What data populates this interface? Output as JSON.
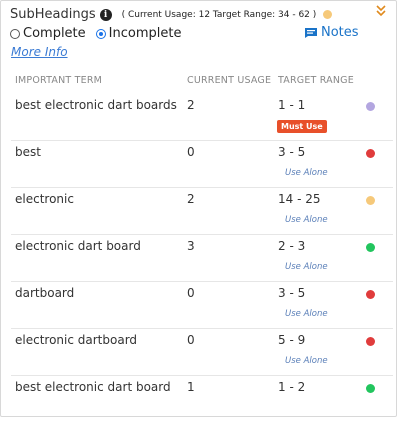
{
  "header": {
    "title": "SubHeadings",
    "usage_text": "( Current Usage: 12 Target Range: 34 - 62 )",
    "status_color": "#f6c97a",
    "collapse_icon": "chevron-double-down-icon"
  },
  "filters": {
    "complete_label": "Complete",
    "incomplete_label": "Incomplete",
    "selected": "Incomplete"
  },
  "notes_label": "Notes",
  "more_info_label": "More Info",
  "columns": {
    "term": "IMPORTANT TERM",
    "usage": "CURRENT USAGE",
    "range": "TARGET RANGE"
  },
  "rows": [
    {
      "term": "best electronic dart boards",
      "usage": "2",
      "range": "1 - 1",
      "badge": "Must Use",
      "note": "",
      "color": "#b3a6e0"
    },
    {
      "term": "best",
      "usage": "0",
      "range": "3 - 5",
      "badge": "",
      "note": "Use Alone",
      "color": "#e03c3c"
    },
    {
      "term": "electronic",
      "usage": "2",
      "range": "14 - 25",
      "badge": "",
      "note": "Use Alone",
      "color": "#f6c97a"
    },
    {
      "term": "electronic dart board",
      "usage": "3",
      "range": "2 - 3",
      "badge": "",
      "note": "Use Alone",
      "color": "#22c55e"
    },
    {
      "term": "dartboard",
      "usage": "0",
      "range": "3 - 5",
      "badge": "",
      "note": "Use Alone",
      "color": "#e03c3c"
    },
    {
      "term": "electronic dartboard",
      "usage": "0",
      "range": "5 - 9",
      "badge": "",
      "note": "Use Alone",
      "color": "#e03c3c"
    },
    {
      "term": "best electronic dart board",
      "usage": "1",
      "range": "1 - 2",
      "badge": "",
      "note": "",
      "color": "#22c55e"
    }
  ]
}
